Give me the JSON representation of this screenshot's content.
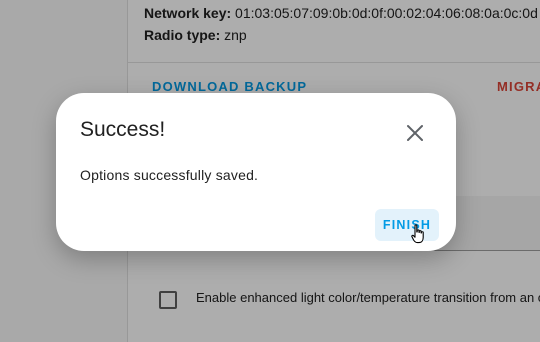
{
  "background": {
    "network_key_label": "Network key:",
    "network_key_value": "01:03:05:07:09:0b:0d:0f:00:02:04:06:08:0a:0c:0d",
    "radio_type_label": "Radio type:",
    "radio_type_value": "znp",
    "download_backup_label": "DOWNLOAD BACKUP",
    "migrate_label": "MIGRA",
    "checkbox_label": "Enable enhanced light color/temperature transition from an o"
  },
  "dialog": {
    "title": "Success!",
    "message": "Options successfully saved.",
    "finish_label": "FINISH"
  },
  "icons": {
    "close": "close-icon",
    "cursor": "hand-pointer-icon"
  },
  "colors": {
    "accent": "#039be5",
    "danger": "#db4437",
    "scrim": "rgba(0,0,0,0.32)"
  }
}
